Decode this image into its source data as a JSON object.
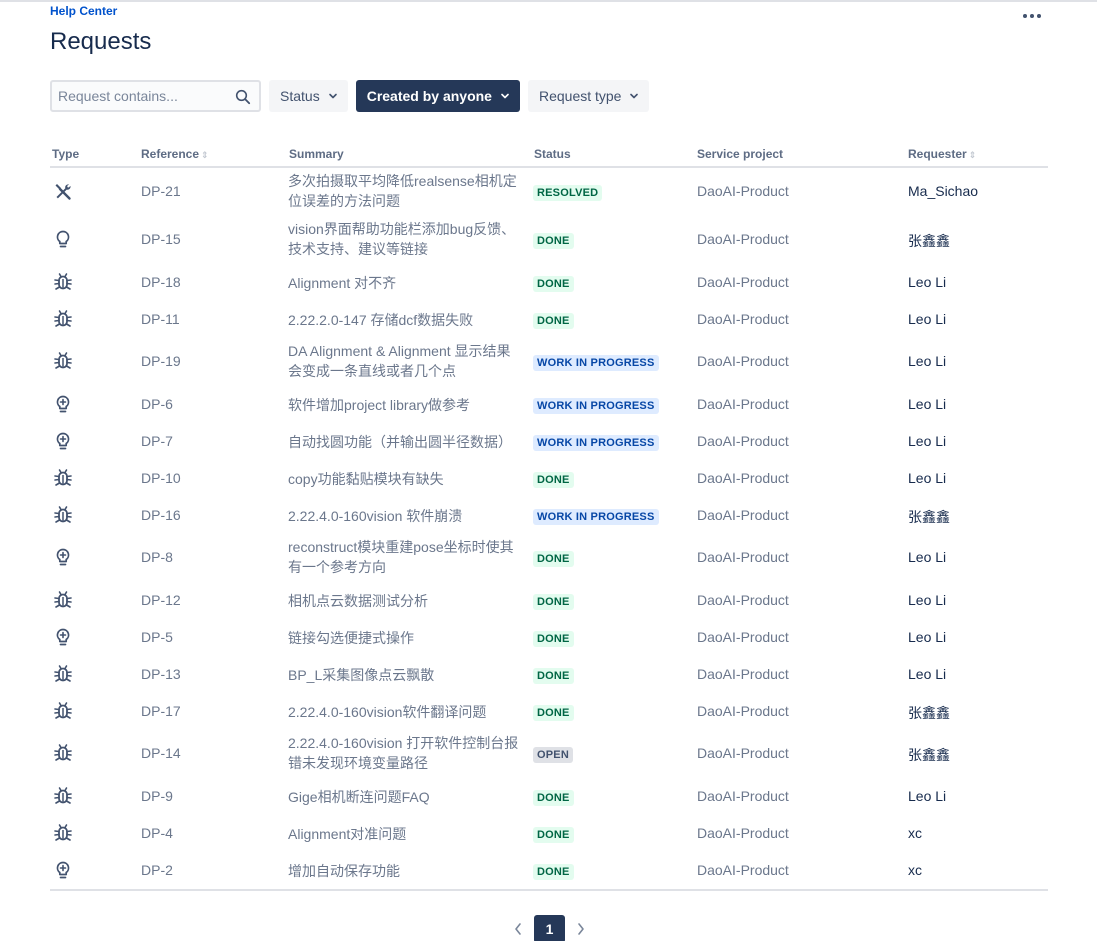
{
  "header": {
    "help_center": "Help Center",
    "title": "Requests",
    "more_icon": "more-horizontal-icon"
  },
  "filters": {
    "search_placeholder": "Request contains...",
    "status_label": "Status",
    "created_by_label": "Created by anyone",
    "request_type_label": "Request type"
  },
  "table": {
    "columns": {
      "type": "Type",
      "reference": "Reference",
      "summary": "Summary",
      "status": "Status",
      "service_project": "Service project",
      "requester": "Requester"
    },
    "rows": [
      {
        "type": "wrench-screwdriver-icon",
        "ref": "DP-21",
        "summary": "多次拍摄取平均降低realsense相机定位误差的方法问题",
        "status": "RESOLVED",
        "status_kind": "done",
        "project": "DaoAI-Product",
        "requester": "Ma_Sichao"
      },
      {
        "type": "lightbulb-icon",
        "ref": "DP-15",
        "summary": "vision界面帮助功能栏添加bug反馈、技术支持、建议等链接",
        "status": "DONE",
        "status_kind": "done",
        "project": "DaoAI-Product",
        "requester": "张鑫鑫"
      },
      {
        "type": "bug-icon",
        "ref": "DP-18",
        "summary": "Alignment 对不齐",
        "status": "DONE",
        "status_kind": "done",
        "project": "DaoAI-Product",
        "requester": "Leo Li"
      },
      {
        "type": "bug-icon",
        "ref": "DP-11",
        "summary": "2.22.2.0-147 存储dcf数据失败",
        "status": "DONE",
        "status_kind": "done",
        "project": "DaoAI-Product",
        "requester": "Leo Li"
      },
      {
        "type": "bug-icon",
        "ref": "DP-19",
        "summary": "DA Alignment & Alignment 显示结果会变成一条直线或者几个点",
        "status": "WORK IN PROGRESS",
        "status_kind": "wip",
        "project": "DaoAI-Product",
        "requester": "Leo Li"
      },
      {
        "type": "lightbulb-plus-icon",
        "ref": "DP-6",
        "summary": "软件增加project library做参考",
        "status": "WORK IN PROGRESS",
        "status_kind": "wip",
        "project": "DaoAI-Product",
        "requester": "Leo Li"
      },
      {
        "type": "lightbulb-plus-icon",
        "ref": "DP-7",
        "summary": "自动找圆功能（并输出圆半径数据）",
        "status": "WORK IN PROGRESS",
        "status_kind": "wip",
        "project": "DaoAI-Product",
        "requester": "Leo Li"
      },
      {
        "type": "bug-icon",
        "ref": "DP-10",
        "summary": "copy功能黏贴模块有缺失",
        "status": "DONE",
        "status_kind": "done",
        "project": "DaoAI-Product",
        "requester": "Leo Li"
      },
      {
        "type": "bug-icon",
        "ref": "DP-16",
        "summary": "2.22.4.0-160vision 软件崩溃",
        "status": "WORK IN PROGRESS",
        "status_kind": "wip",
        "project": "DaoAI-Product",
        "requester": "张鑫鑫"
      },
      {
        "type": "lightbulb-plus-icon",
        "ref": "DP-8",
        "summary": "reconstruct模块重建pose坐标时使其有一个参考方向",
        "status": "DONE",
        "status_kind": "done",
        "project": "DaoAI-Product",
        "requester": "Leo Li"
      },
      {
        "type": "bug-icon",
        "ref": "DP-12",
        "summary": "相机点云数据测试分析",
        "status": "DONE",
        "status_kind": "done",
        "project": "DaoAI-Product",
        "requester": "Leo Li"
      },
      {
        "type": "lightbulb-plus-icon",
        "ref": "DP-5",
        "summary": "链接勾选便捷式操作",
        "status": "DONE",
        "status_kind": "done",
        "project": "DaoAI-Product",
        "requester": "Leo Li"
      },
      {
        "type": "bug-icon",
        "ref": "DP-13",
        "summary": "BP_L采集图像点云飘散",
        "status": "DONE",
        "status_kind": "done",
        "project": "DaoAI-Product",
        "requester": "Leo Li"
      },
      {
        "type": "bug-icon",
        "ref": "DP-17",
        "summary": "2.22.4.0-160vision软件翻译问题",
        "status": "DONE",
        "status_kind": "done",
        "project": "DaoAI-Product",
        "requester": "张鑫鑫"
      },
      {
        "type": "bug-icon",
        "ref": "DP-14",
        "summary": "2.22.4.0-160vision 打开软件控制台报错未发现环境变量路径",
        "status": "OPEN",
        "status_kind": "open",
        "project": "DaoAI-Product",
        "requester": "张鑫鑫"
      },
      {
        "type": "bug-icon",
        "ref": "DP-9",
        "summary": "Gige相机断连问题FAQ",
        "status": "DONE",
        "status_kind": "done",
        "project": "DaoAI-Product",
        "requester": "Leo Li"
      },
      {
        "type": "bug-icon",
        "ref": "DP-4",
        "summary": "Alignment对准问题",
        "status": "DONE",
        "status_kind": "done",
        "project": "DaoAI-Product",
        "requester": "xc"
      },
      {
        "type": "lightbulb-plus-icon",
        "ref": "DP-2",
        "summary": "增加自动保存功能",
        "status": "DONE",
        "status_kind": "done",
        "project": "DaoAI-Product",
        "requester": "xc"
      }
    ]
  },
  "pagination": {
    "current_page": "1",
    "prev_icon": "chevron-left-icon",
    "next_icon": "chevron-right-icon"
  },
  "colors": {
    "link": "#0052cc",
    "primary_button": "#253858",
    "done_bg": "#e3fcef",
    "done_text": "#006644",
    "wip_bg": "#deebff",
    "wip_text": "#0747a6",
    "open_bg": "#dfe1e6",
    "open_text": "#42526e"
  }
}
